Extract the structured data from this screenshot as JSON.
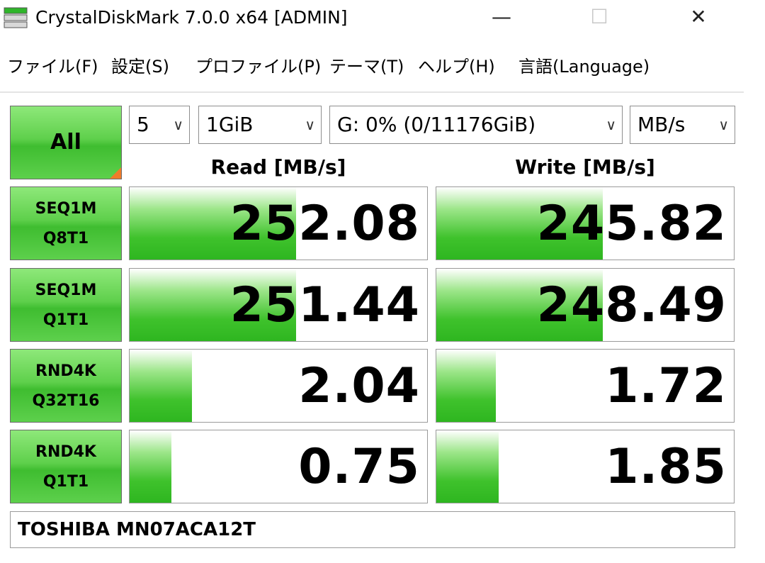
{
  "window": {
    "title": "CrystalDiskMark 7.0.0 x64 [ADMIN]",
    "minimize_glyph": "—",
    "maximize_glyph": "☐",
    "close_glyph": "✕"
  },
  "menu": [
    {
      "label": "ファイル(F)"
    },
    {
      "label": "設定(S)"
    },
    {
      "label": "プロファイル(P)"
    },
    {
      "label": "テーマ(T)"
    },
    {
      "label": "ヘルプ(H)"
    },
    {
      "label": "言語(Language)"
    }
  ],
  "controls": {
    "all_label": "All",
    "count": "5",
    "size": "1GiB",
    "drive": "G: 0% (0/11176GiB)",
    "unit": "MB/s"
  },
  "headers": {
    "read": "Read [MB/s]",
    "write": "Write [MB/s]"
  },
  "tests": [
    {
      "line1": "SEQ1M",
      "line2": "Q8T1",
      "read": "252.08",
      "write": "245.82",
      "read_fill": 0.56,
      "write_fill": 0.56
    },
    {
      "line1": "SEQ1M",
      "line2": "Q1T1",
      "read": "251.44",
      "write": "248.49",
      "read_fill": 0.56,
      "write_fill": 0.56
    },
    {
      "line1": "RND4K",
      "line2": "Q32T16",
      "read": "2.04",
      "write": "1.72",
      "read_fill": 0.21,
      "write_fill": 0.2
    },
    {
      "line1": "RND4K",
      "line2": "Q1T1",
      "read": "0.75",
      "write": "1.85",
      "read_fill": 0.14,
      "write_fill": 0.21
    }
  ],
  "drive_name": "TOSHIBA MN07ACA12T",
  "colors": {
    "bar_green": "#3fc22c",
    "button_green": "#5fd04c",
    "all_corner": "#f07b2a"
  }
}
